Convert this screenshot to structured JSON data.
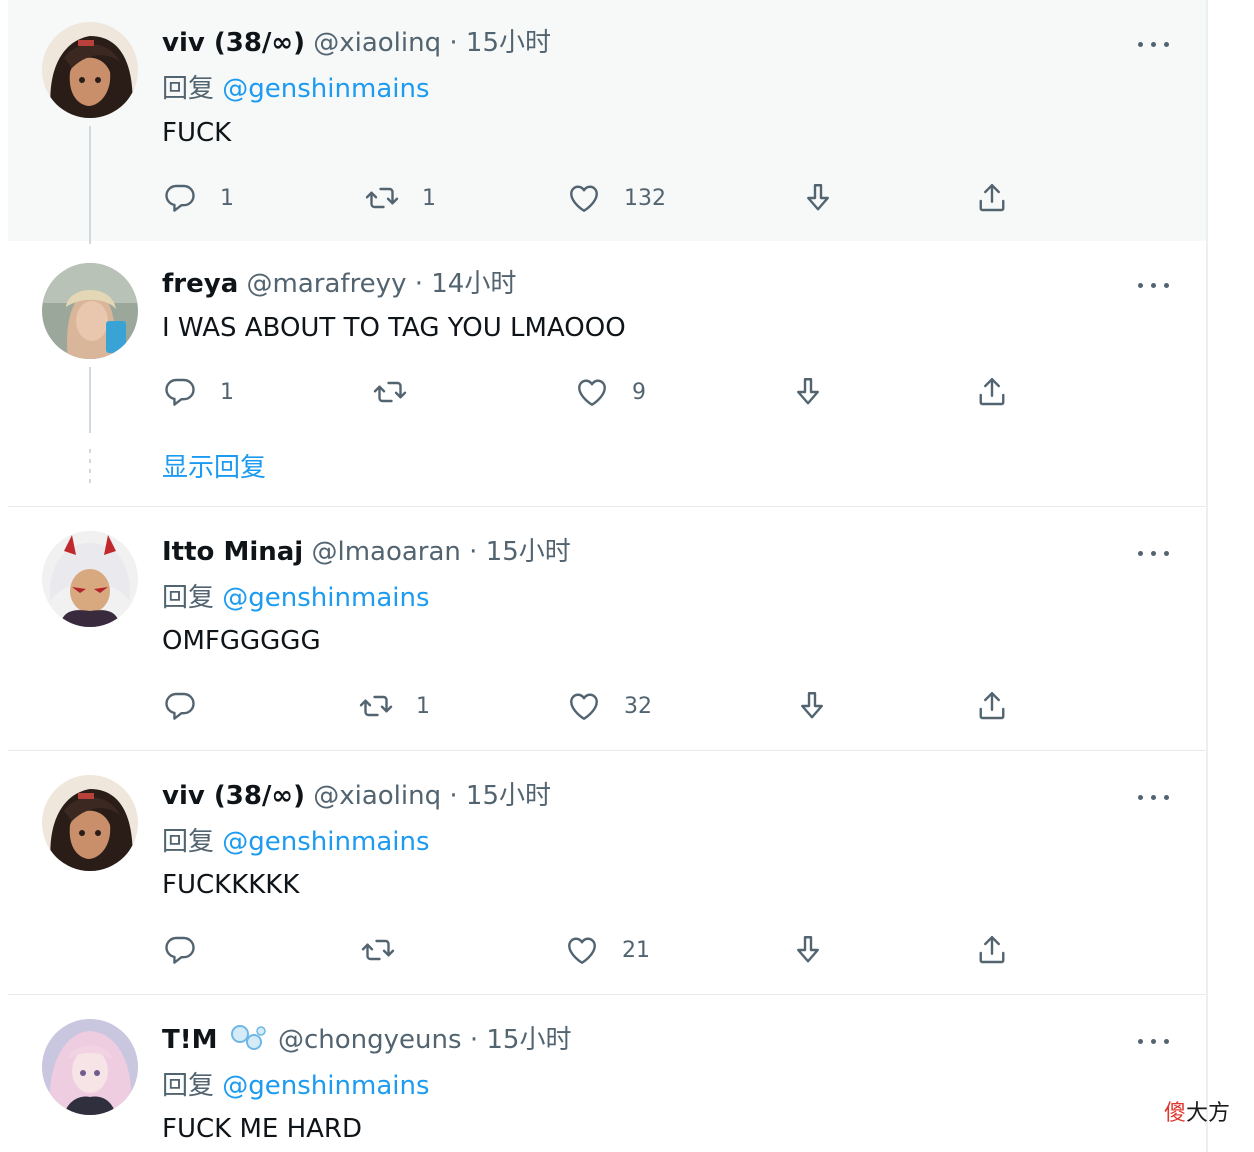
{
  "colors": {
    "link": "#1d9bf0",
    "secondary_text": "#536471",
    "primary_text": "#0f1419",
    "highlight_bg": "#f7f9f9"
  },
  "tweets": [
    {
      "name": "viv (38/∞)",
      "handle": "@xiaolinq",
      "separator": "·",
      "time": "15小时",
      "reply_prefix": "回复",
      "reply_mention": "@genshinmains",
      "text": "FUCK",
      "replies": "1",
      "retweets": "1",
      "likes": "132",
      "avatar_icon": "dark-haired-character-avatar"
    },
    {
      "name": "freya",
      "handle": "@marafreyy",
      "separator": "·",
      "time": "14小时",
      "text": "I WAS ABOUT TO TAG YOU LMAOOO",
      "replies": "1",
      "retweets": "",
      "likes": "9",
      "avatar_icon": "photo-avatar",
      "show_replies": "显示回复"
    },
    {
      "name": "Itto Minaj",
      "handle": "@lmaoaran",
      "separator": "·",
      "time": "15小时",
      "reply_prefix": "回复",
      "reply_mention": "@genshinmains",
      "text": "OMFGGGGG",
      "replies": "",
      "retweets": "1",
      "likes": "32",
      "avatar_icon": "horned-character-avatar"
    },
    {
      "name": "viv (38/∞)",
      "handle": "@xiaolinq",
      "separator": "·",
      "time": "15小时",
      "reply_prefix": "回复",
      "reply_mention": "@genshinmains",
      "text": "FUCKKKKK",
      "replies": "",
      "retweets": "",
      "likes": "21",
      "avatar_icon": "dark-haired-character-avatar"
    },
    {
      "name": "T!M",
      "handle": "@chongyeuns",
      "separator": "·",
      "time": "15小时",
      "reply_prefix": "回复",
      "reply_mention": "@genshinmains",
      "text": "FUCK ME HARD",
      "avatar_icon": "pink-haired-character-avatar",
      "name_emoji": "bubbles-emoji"
    }
  ],
  "watermark": {
    "part1": "傻",
    "part2": "大方"
  }
}
